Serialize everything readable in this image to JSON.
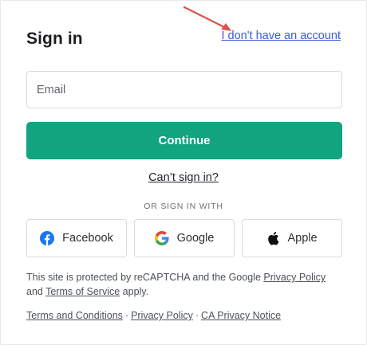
{
  "header": {
    "title": "Sign in",
    "no_account_link": "I don't have an account"
  },
  "email": {
    "placeholder": "Email",
    "value": ""
  },
  "continue_label": "Continue",
  "cant_sign_in": "Can’t sign in?",
  "or_sign_in_with": "OR SIGN IN WITH",
  "social": {
    "facebook": "Facebook",
    "google": "Google",
    "apple": "Apple"
  },
  "legal": {
    "text_before": "This site is protected by reCAPTCHA and the Google ",
    "privacy_policy": "Privacy Policy",
    "and": "and ",
    "terms_of_service": "Terms of Service",
    "text_after": " apply."
  },
  "footer": {
    "terms": "Terms and Conditions",
    "privacy": "Privacy Policy",
    "ca_privacy": "CA Privacy Notice",
    "separator": "·"
  },
  "colors": {
    "accent": "#12a37f",
    "link": "#3b5bdb",
    "annotation_arrow": "#d9534f",
    "facebook": "#1877f2"
  },
  "icons": [
    "facebook-icon",
    "google-icon",
    "apple-icon",
    "annotation-arrow-icon"
  ]
}
